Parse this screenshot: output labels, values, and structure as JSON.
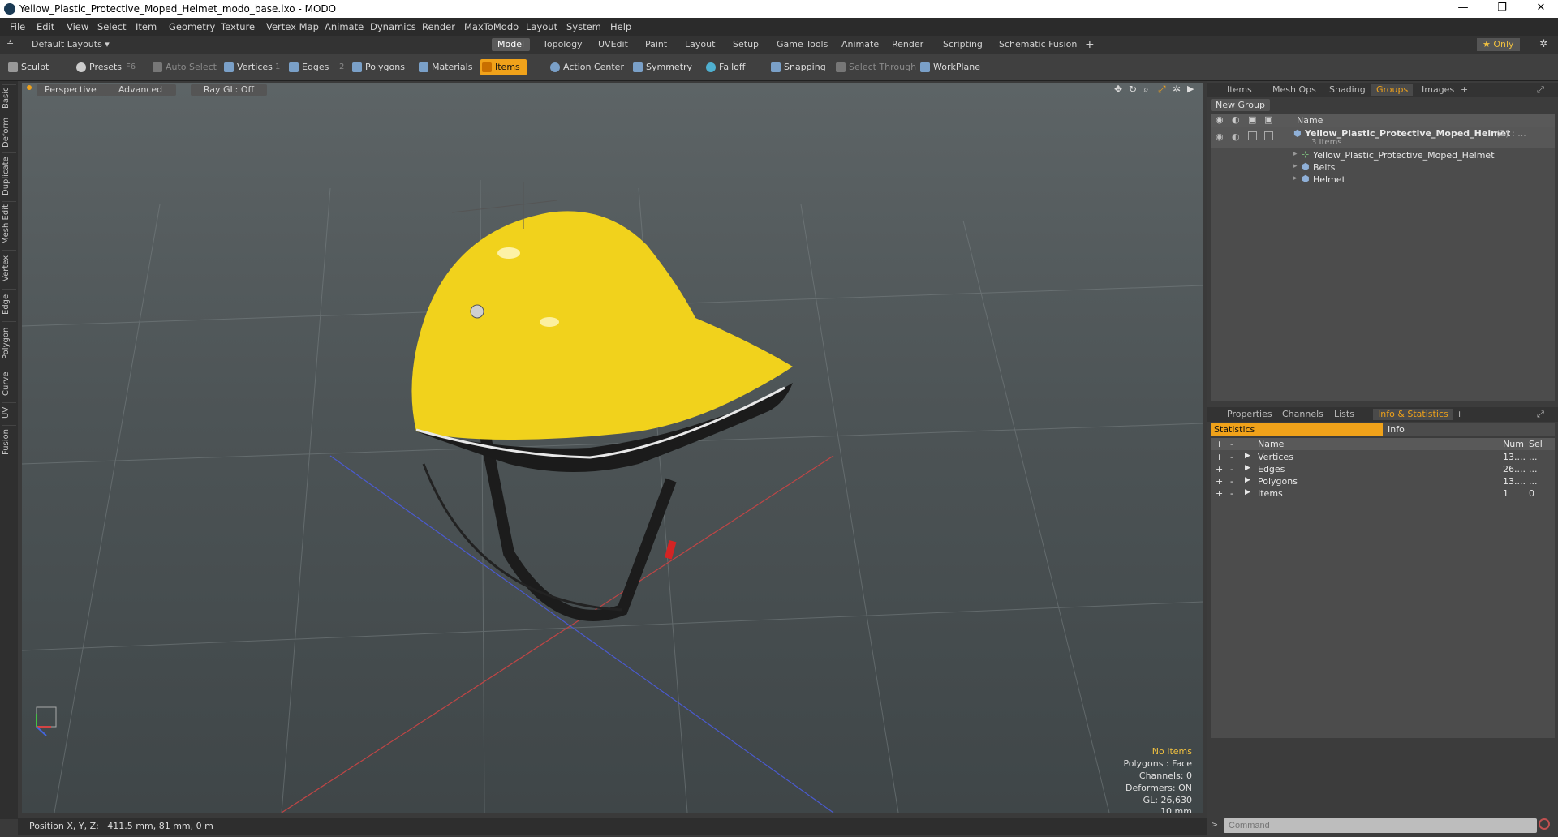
{
  "window": {
    "title": "Yellow_Plastic_Protective_Moped_Helmet_modo_base.lxo - MODO"
  },
  "menu": [
    "File",
    "Edit",
    "View",
    "Select",
    "Item",
    "Geometry",
    "Texture",
    "Vertex Map",
    "Animate",
    "Dynamics",
    "Render",
    "MaxToModo",
    "Layout",
    "System",
    "Help"
  ],
  "layout_selector": "Default Layouts ▾",
  "layout_tabs": [
    "Model",
    "Topology",
    "UVEdit",
    "Paint",
    "Layout",
    "Setup",
    "Game Tools",
    "Animate",
    "Render",
    "Scripting",
    "Schematic Fusion"
  ],
  "only_label": "★ Only",
  "toolbar": {
    "sculpt": "Sculpt",
    "presets": "Presets",
    "presets_key": "F6",
    "auto_select": "Auto Select",
    "vertices": "Vertices",
    "vertices_key": "1",
    "edges": "Edges",
    "edges_key": "2",
    "polygons": "Polygons",
    "materials": "Materials",
    "items": "Items",
    "action_center": "Action Center",
    "symmetry": "Symmetry",
    "falloff": "Falloff",
    "snapping": "Snapping",
    "select_through": "Select Through",
    "workplane": "WorkPlane"
  },
  "left_tabs": [
    "Basic",
    "Deform",
    "Duplicate",
    "Mesh Edit",
    "Vertex",
    "Edge",
    "Polygon",
    "Curve",
    "UV",
    "Fusion"
  ],
  "viewport": {
    "perspective": "Perspective",
    "advanced": "Advanced",
    "raygl": "Ray GL: Off",
    "info": {
      "no_items": "No Items",
      "polygons": "Polygons : Face",
      "channels": "Channels: 0",
      "deformers": "Deformers: ON",
      "gl": "GL: 26,630",
      "scale": "10 mm"
    }
  },
  "status": {
    "position": "Position X, Y, Z:   411.5 mm, 81 mm, 0 m"
  },
  "items_panel": {
    "tabs": [
      "Items",
      "Mesh Ops",
      "Shading",
      "Groups",
      "Images"
    ],
    "active_tab": "Groups",
    "new_group": "New Group",
    "name_header": "Name",
    "group_name": "Yellow_Plastic_Protective_Moped_Helmet",
    "group_count": "(2) : ...",
    "group_sub": "3 Items",
    "children": [
      "Yellow_Plastic_Protective_Moped_Helmet",
      "Belts",
      "Helmet"
    ]
  },
  "stats_panel": {
    "tabs": [
      "Properties",
      "Channels",
      "Lists",
      "Info & Statistics"
    ],
    "active_tab": "Info & Statistics",
    "sub_tabs": [
      "Statistics",
      "Info"
    ],
    "headers": {
      "name": "Name",
      "num": "Num",
      "sel": "Sel"
    },
    "rows": [
      {
        "name": "Vertices",
        "num": "13....",
        "sel": "..."
      },
      {
        "name": "Edges",
        "num": "26....",
        "sel": "..."
      },
      {
        "name": "Polygons",
        "num": "13....",
        "sel": "..."
      },
      {
        "name": "Items",
        "num": "1",
        "sel": "0"
      }
    ]
  },
  "command": {
    "placeholder": "Command"
  }
}
